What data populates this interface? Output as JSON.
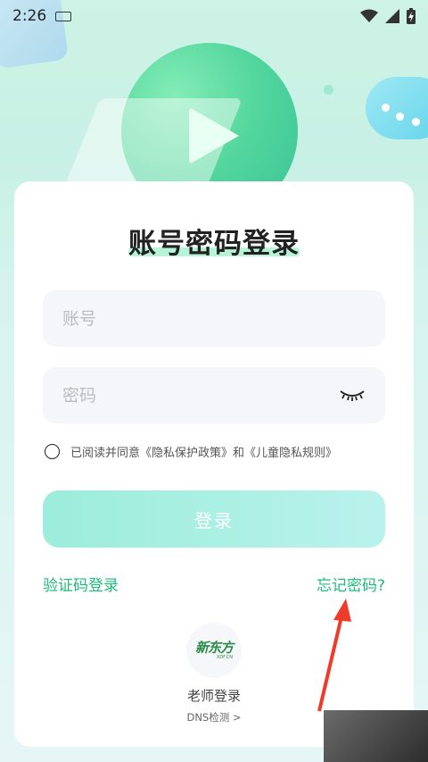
{
  "status_bar": {
    "time": "2:26"
  },
  "login": {
    "title": "账号密码登录",
    "account_placeholder": "账号",
    "password_placeholder": "密码",
    "agreement_text": "已阅读并同意《隐私保护政策》和《儿童隐私规则》",
    "login_button": "登录",
    "code_login": "验证码登录",
    "forgot_password": "忘记密码?"
  },
  "teacher": {
    "logo_text": "新东方",
    "logo_sub": "XDF.CN",
    "label": "老师登录",
    "dns_check": "DNS检测 >"
  },
  "colors": {
    "accent": "#1fba7f",
    "button": "#9ceddb"
  }
}
